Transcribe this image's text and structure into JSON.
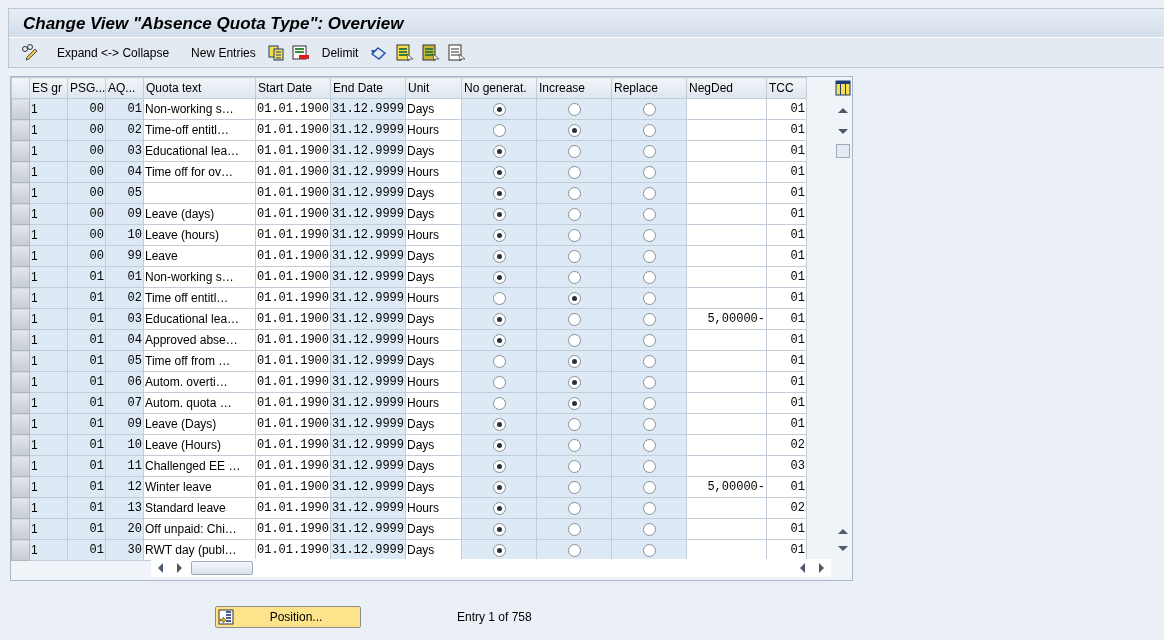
{
  "window": {
    "title": "Change View \"Absence Quota Type\": Overview"
  },
  "toolbar": {
    "items": [
      {
        "kind": "icon"
      },
      {
        "kind": "text",
        "label": "Expand <-> Collapse"
      },
      {
        "kind": "text",
        "label": "New Entries"
      },
      {
        "kind": "icon"
      },
      {
        "kind": "icon"
      },
      {
        "kind": "text",
        "label": "Delimit"
      },
      {
        "kind": "icon"
      },
      {
        "kind": "icon"
      },
      {
        "kind": "icon"
      },
      {
        "kind": "icon"
      }
    ]
  },
  "table": {
    "columns": [
      "ES gr",
      "PSG...",
      "AQ...",
      "Quota text",
      "Start Date",
      "End Date",
      "Unit",
      "No generat.",
      "Increase",
      "Replace",
      "NegDed",
      "TCC"
    ],
    "rows": [
      {
        "es_group": "1",
        "psg": "00",
        "aq": "01",
        "quota_text": "Non-working s…",
        "start_date": "01.01.1900",
        "end_date": "31.12.9999",
        "unit": "Days",
        "no_generation": true,
        "increase": false,
        "replace": false,
        "tcc": "01"
      },
      {
        "es_group": "1",
        "psg": "00",
        "aq": "02",
        "quota_text": "Time-off entitl…",
        "start_date": "01.01.1900",
        "end_date": "31.12.9999",
        "unit": "Hours",
        "no_generation": false,
        "increase": true,
        "replace": false,
        "tcc": "01"
      },
      {
        "es_group": "1",
        "psg": "00",
        "aq": "03",
        "quota_text": "Educational lea…",
        "start_date": "01.01.1900",
        "end_date": "31.12.9999",
        "unit": "Days",
        "no_generation": true,
        "increase": false,
        "replace": false,
        "tcc": "01"
      },
      {
        "es_group": "1",
        "psg": "00",
        "aq": "04",
        "quota_text": "Time off for ov…",
        "start_date": "01.01.1900",
        "end_date": "31.12.9999",
        "unit": "Hours",
        "no_generation": true,
        "increase": false,
        "replace": false,
        "tcc": "01"
      },
      {
        "es_group": "1",
        "psg": "00",
        "aq": "05",
        "start_date": "01.01.1900",
        "end_date": "31.12.9999",
        "unit": "Days",
        "no_generation": true,
        "increase": false,
        "replace": false,
        "tcc": "01"
      },
      {
        "es_group": "1",
        "psg": "00",
        "aq": "09",
        "quota_text": "Leave (days)",
        "start_date": "01.01.1900",
        "end_date": "31.12.9999",
        "unit": "Days",
        "no_generation": true,
        "increase": false,
        "replace": false,
        "tcc": "01"
      },
      {
        "es_group": "1",
        "psg": "00",
        "aq": "10",
        "quota_text": "Leave (hours)",
        "start_date": "01.01.1990",
        "end_date": "31.12.9999",
        "unit": "Hours",
        "no_generation": true,
        "increase": false,
        "replace": false,
        "tcc": "01"
      },
      {
        "es_group": "1",
        "psg": "00",
        "aq": "99",
        "quota_text": "Leave",
        "start_date": "01.01.1900",
        "end_date": "31.12.9999",
        "unit": "Days",
        "no_generation": true,
        "increase": false,
        "replace": false,
        "tcc": "01"
      },
      {
        "es_group": "1",
        "psg": "01",
        "aq": "01",
        "quota_text": "Non-working s…",
        "start_date": "01.01.1900",
        "end_date": "31.12.9999",
        "unit": "Days",
        "no_generation": true,
        "increase": false,
        "replace": false,
        "tcc": "01"
      },
      {
        "es_group": "1",
        "psg": "01",
        "aq": "02",
        "quota_text": "Time off entitl…",
        "start_date": "01.01.1990",
        "end_date": "31.12.9999",
        "unit": "Hours",
        "no_generation": false,
        "increase": true,
        "replace": false,
        "tcc": "01"
      },
      {
        "es_group": "1",
        "psg": "01",
        "aq": "03",
        "quota_text": "Educational lea…",
        "start_date": "01.01.1900",
        "end_date": "31.12.9999",
        "unit": "Days",
        "no_generation": true,
        "increase": false,
        "replace": false,
        "neg_ded": "5,00000-",
        "tcc": "01"
      },
      {
        "es_group": "1",
        "psg": "01",
        "aq": "04",
        "quota_text": "Approved abse…",
        "start_date": "01.01.1900",
        "end_date": "31.12.9999",
        "unit": "Hours",
        "no_generation": true,
        "increase": false,
        "replace": false,
        "tcc": "01"
      },
      {
        "es_group": "1",
        "psg": "01",
        "aq": "05",
        "quota_text": "Time off from …",
        "start_date": "01.01.1900",
        "end_date": "31.12.9999",
        "unit": "Days",
        "no_generation": false,
        "increase": true,
        "replace": false,
        "tcc": "01"
      },
      {
        "es_group": "1",
        "psg": "01",
        "aq": "06",
        "quota_text": "Autom. overti…",
        "start_date": "01.01.1990",
        "end_date": "31.12.9999",
        "unit": "Hours",
        "no_generation": false,
        "increase": true,
        "replace": false,
        "tcc": "01"
      },
      {
        "es_group": "1",
        "psg": "01",
        "aq": "07",
        "quota_text": "Autom. quota …",
        "start_date": "01.01.1990",
        "end_date": "31.12.9999",
        "unit": "Hours",
        "no_generation": false,
        "increase": true,
        "replace": false,
        "tcc": "01"
      },
      {
        "es_group": "1",
        "psg": "01",
        "aq": "09",
        "quota_text": "Leave (Days)",
        "start_date": "01.01.1900",
        "end_date": "31.12.9999",
        "unit": "Days",
        "no_generation": true,
        "increase": false,
        "replace": false,
        "tcc": "01"
      },
      {
        "es_group": "1",
        "psg": "01",
        "aq": "10",
        "quota_text": "Leave (Hours)",
        "start_date": "01.01.1990",
        "end_date": "31.12.9999",
        "unit": "Days",
        "no_generation": true,
        "increase": false,
        "replace": false,
        "tcc": "02"
      },
      {
        "es_group": "1",
        "psg": "01",
        "aq": "11",
        "quota_text": "Challenged EE …",
        "start_date": "01.01.1990",
        "end_date": "31.12.9999",
        "unit": "Days",
        "no_generation": true,
        "increase": false,
        "replace": false,
        "tcc": "03"
      },
      {
        "es_group": "1",
        "psg": "01",
        "aq": "12",
        "quota_text": "Winter leave",
        "start_date": "01.01.1900",
        "end_date": "31.12.9999",
        "unit": "Days",
        "no_generation": true,
        "increase": false,
        "replace": false,
        "neg_ded": "5,00000-",
        "tcc": "01"
      },
      {
        "es_group": "1",
        "psg": "01",
        "aq": "13",
        "quota_text": "Standard leave",
        "start_date": "01.01.1990",
        "end_date": "31.12.9999",
        "unit": "Hours",
        "no_generation": true,
        "increase": false,
        "replace": false,
        "tcc": "02"
      },
      {
        "es_group": "1",
        "psg": "01",
        "aq": "20",
        "quota_text": "Off unpaid: Chi…",
        "start_date": "01.01.1990",
        "end_date": "31.12.9999",
        "unit": "Days",
        "no_generation": true,
        "increase": false,
        "replace": false,
        "tcc": "01"
      },
      {
        "es_group": "1",
        "psg": "01",
        "aq": "30",
        "quota_text": "RWT day (publ…",
        "start_date": "01.01.1990",
        "end_date": "31.12.9999",
        "unit": "Days",
        "no_generation": true,
        "increase": false,
        "replace": false,
        "tcc": "01"
      }
    ]
  },
  "footer": {
    "position_button": "Position...",
    "entry_info": "Entry 1 of 758"
  }
}
